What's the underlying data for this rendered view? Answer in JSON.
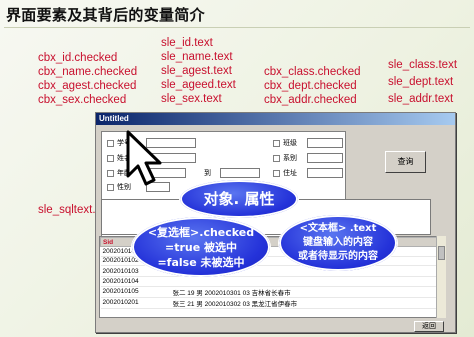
{
  "slide": {
    "title": "界面要素及其背后的变量简介"
  },
  "variables": {
    "sle_id": "sle_id.text",
    "sle_name": "sle_name.text",
    "sle_agest": "sle_agest.text",
    "sle_ageed": "sle_ageed.text",
    "sle_sex": "sle_sex.text",
    "cbx_id": "cbx_id.checked",
    "cbx_name": "cbx_name.checked",
    "cbx_agest": "cbx_agest.checked",
    "cbx_sex": "cbx_sex.checked",
    "cbx_class": "cbx_class.checked",
    "cbx_dept": "cbx_dept.checked",
    "cbx_addr": "cbx_addr.checked",
    "sle_class": "sle_class.text",
    "sle_dept": "sle_dept.text",
    "sle_addr": "sle_addr.text",
    "sle_sqltext": "sle_sqltext.text"
  },
  "window": {
    "title": "Untitled",
    "labels": {
      "id": "学号",
      "name": "姓名",
      "age": "年龄",
      "to": "到",
      "sex": "性别",
      "class": "班级",
      "dept": "系别",
      "addr": "住址"
    },
    "query_button": "查询",
    "return_button": "返回"
  },
  "grid": {
    "header_sid": "Sid",
    "rows": [
      {
        "sid": "2002010101",
        "rest": ""
      },
      {
        "sid": "2002010102",
        "rest": ""
      },
      {
        "sid": "2002010103",
        "rest": "王"
      },
      {
        "sid": "2002010104",
        "rest": ""
      },
      {
        "sid": "2002010105",
        "rest": "张二      19 男   2002010301      03      吉林省长春市"
      },
      {
        "sid": "2002010201",
        "rest": "张三      21 男   2002010302      03      黑龙江省伊春市"
      }
    ]
  },
  "overlays": {
    "title_oval": "对象. 属性",
    "left_line1": "<复选框>.checked",
    "left_line2": "=true 被选中",
    "left_line3": "=false 未被选中",
    "right_line1": "<文本框> .text",
    "right_line2": "键盘输入的内容",
    "right_line3": "或者待显示的内容"
  },
  "colors": {
    "field_text_blue": "#1a1aa8",
    "checked_red": "#c8102e",
    "oval_blue": "#2432d9"
  }
}
